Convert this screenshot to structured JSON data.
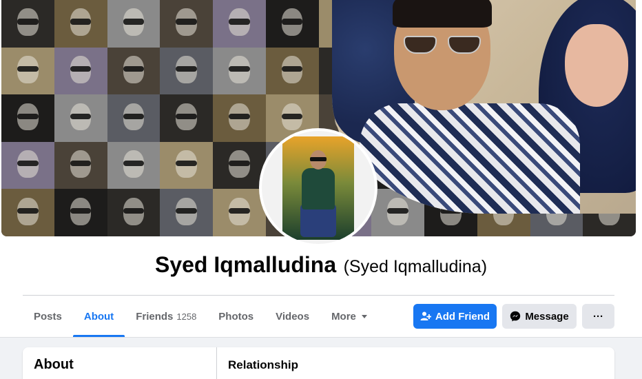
{
  "profile": {
    "name": "Syed Iqmalludina",
    "alternate_name": "(Syed Iqmalludina)"
  },
  "tabs": [
    {
      "label": "Posts",
      "active": false
    },
    {
      "label": "About",
      "active": true
    },
    {
      "label": "Friends",
      "count": "1258",
      "active": false
    },
    {
      "label": "Photos",
      "active": false
    },
    {
      "label": "Videos",
      "active": false
    },
    {
      "label": "More",
      "active": false
    }
  ],
  "actions": {
    "add_friend_label": "Add Friend",
    "message_label": "Message",
    "more_label": "···"
  },
  "about": {
    "title": "About",
    "section_title": "Relationship"
  },
  "colors": {
    "accent": "#1877f2",
    "secondary_button": "#e4e6eb",
    "page_background": "#f0f2f5"
  },
  "icons": [
    "add-friend-icon",
    "messenger-icon",
    "chevron-down-icon",
    "more-options-icon"
  ]
}
